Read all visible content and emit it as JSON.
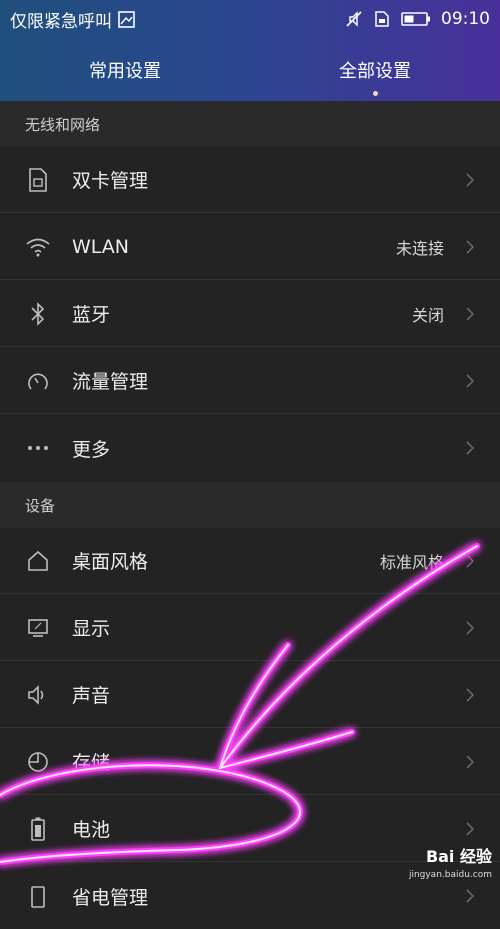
{
  "status_bar": {
    "carrier_text": "仅限紧急呼叫",
    "time": "09:10",
    "icons": [
      "image-icon",
      "mute-icon",
      "sim-icon",
      "battery-icon"
    ]
  },
  "tabs": [
    {
      "label": "常用设置",
      "active": false
    },
    {
      "label": "全部设置",
      "active": true
    }
  ],
  "sections": [
    {
      "title": "无线和网络",
      "items": [
        {
          "label": "双卡管理",
          "value": "",
          "icon": "sim-card-icon"
        },
        {
          "label": "WLAN",
          "value": "未连接",
          "icon": "wifi-icon"
        },
        {
          "label": "蓝牙",
          "value": "关闭",
          "icon": "bluetooth-icon"
        },
        {
          "label": "流量管理",
          "value": "",
          "icon": "data-usage-icon"
        },
        {
          "label": "更多",
          "value": "",
          "icon": "more-icon"
        }
      ]
    },
    {
      "title": "设备",
      "items": [
        {
          "label": "桌面风格",
          "value": "标准风格",
          "icon": "home-icon"
        },
        {
          "label": "显示",
          "value": "",
          "icon": "display-icon"
        },
        {
          "label": "声音",
          "value": "",
          "icon": "speaker-icon"
        },
        {
          "label": "存储",
          "value": "",
          "icon": "storage-icon"
        },
        {
          "label": "电池",
          "value": "",
          "icon": "battery-icon"
        },
        {
          "label": "省电管理",
          "value": "",
          "icon": "power-saving-icon"
        }
      ]
    }
  ],
  "watermark": {
    "brand": "Bai 经验",
    "url": "jingyan.baidu.com"
  },
  "colors": {
    "header_start": "#1f4f7c",
    "header_end": "#48309a",
    "background": "#232323",
    "annotation": "#ff40ff"
  }
}
